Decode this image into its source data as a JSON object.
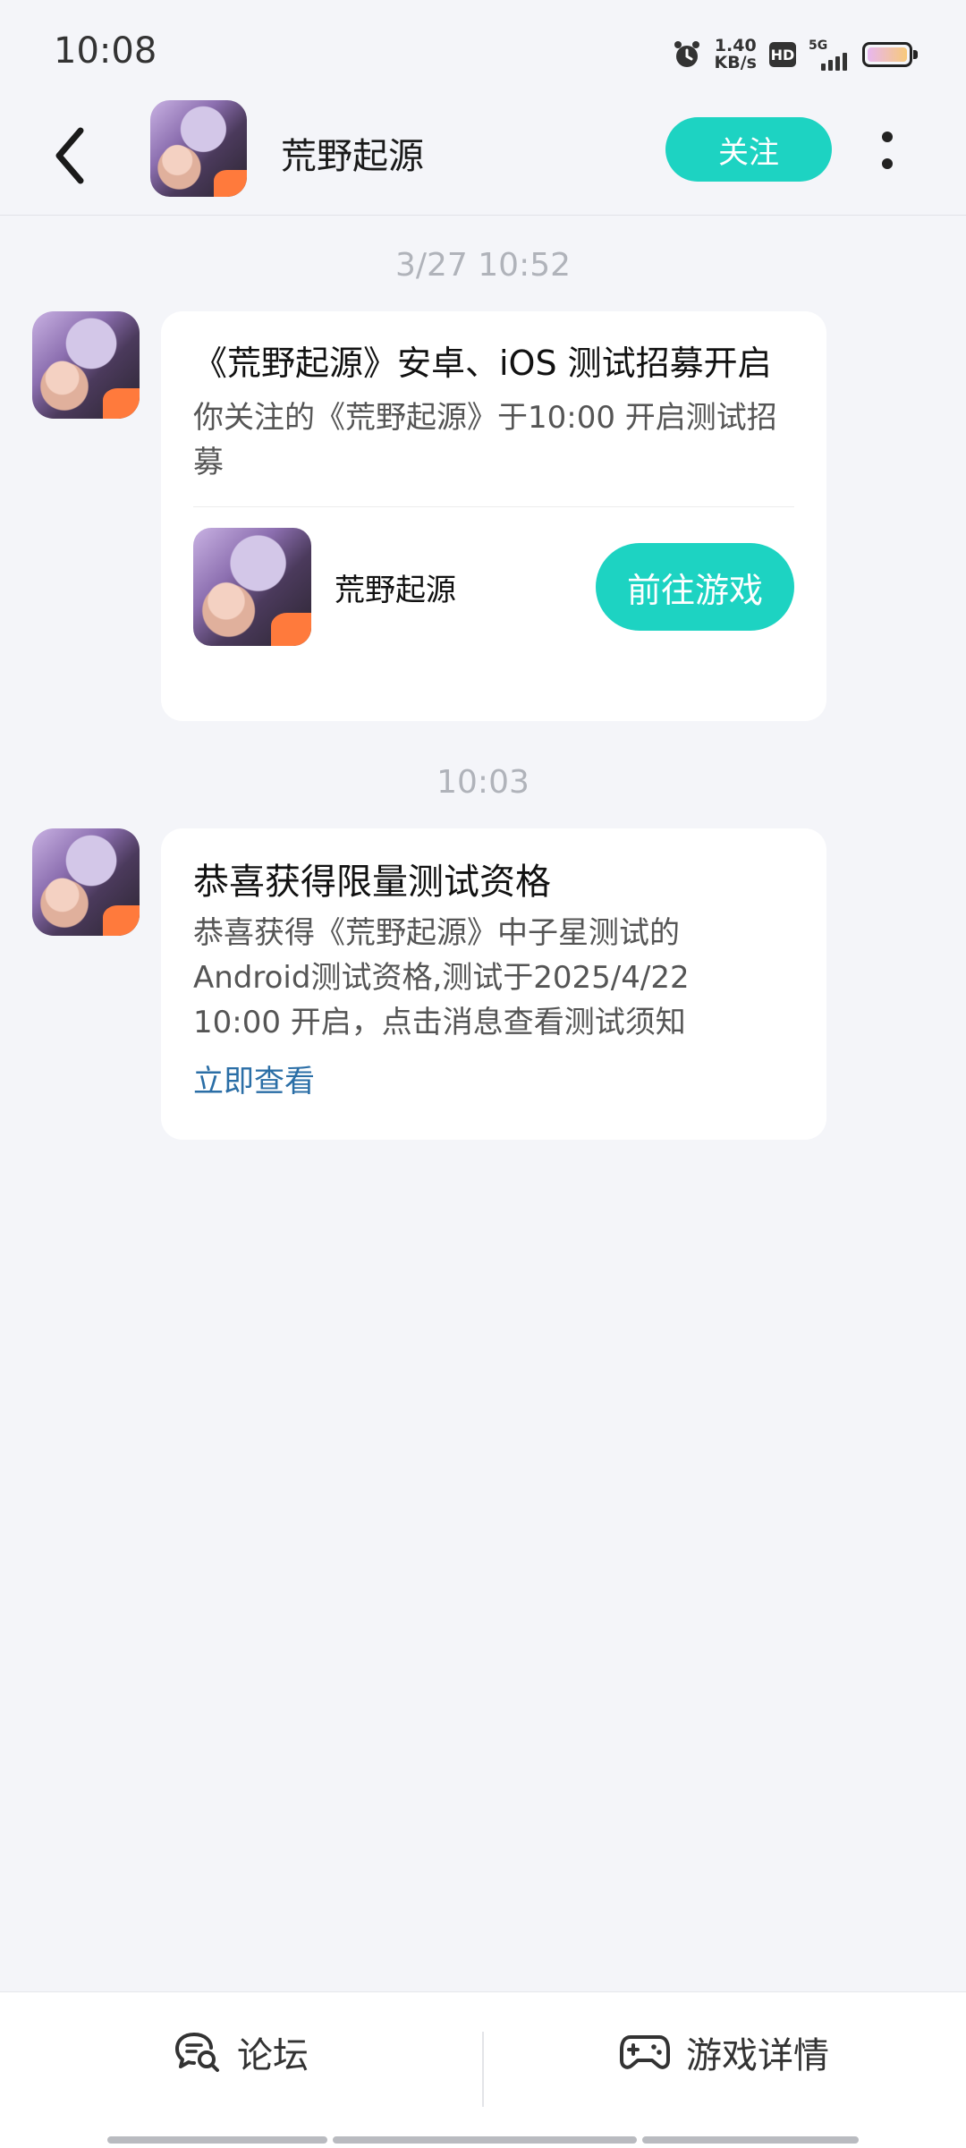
{
  "status_bar": {
    "time": "10:08",
    "net_speed_value": "1.40",
    "net_speed_unit": "KB/s",
    "hd": "HD",
    "network": "5G",
    "icons": [
      "alarm-icon",
      "hd-icon",
      "signal-icon",
      "battery-icon"
    ]
  },
  "header": {
    "title": "荒野起源",
    "follow_label": "关注",
    "back_icon": "chevron-left-icon",
    "more_icon": "more-vertical-icon"
  },
  "messages": [
    {
      "time": "3/27  10:52",
      "title": "《荒野起源》安卓、iOS 测试招募开启",
      "body": "你关注的《荒野起源》于10:00 开启测试招募",
      "game_name": "荒野起源",
      "button_label": "前往游戏"
    },
    {
      "time": "10:03",
      "title": "恭喜获得限量测试资格",
      "body_line1": "恭喜获得《荒野起源》中子星测试的",
      "body_line2": "Android测试资格,测试于2025/4/22",
      "body_line3": "10:00 开启，点击消息查看测试须知",
      "link_label": "立即查看"
    }
  ],
  "bottom_tabs": [
    {
      "label": "论坛",
      "icon": "chat-search-icon"
    },
    {
      "label": "游戏详情",
      "icon": "gamepad-icon"
    }
  ],
  "colors": {
    "accent": "#1dd3c2",
    "link": "#2a6ea6",
    "background": "#f4f5f9"
  }
}
